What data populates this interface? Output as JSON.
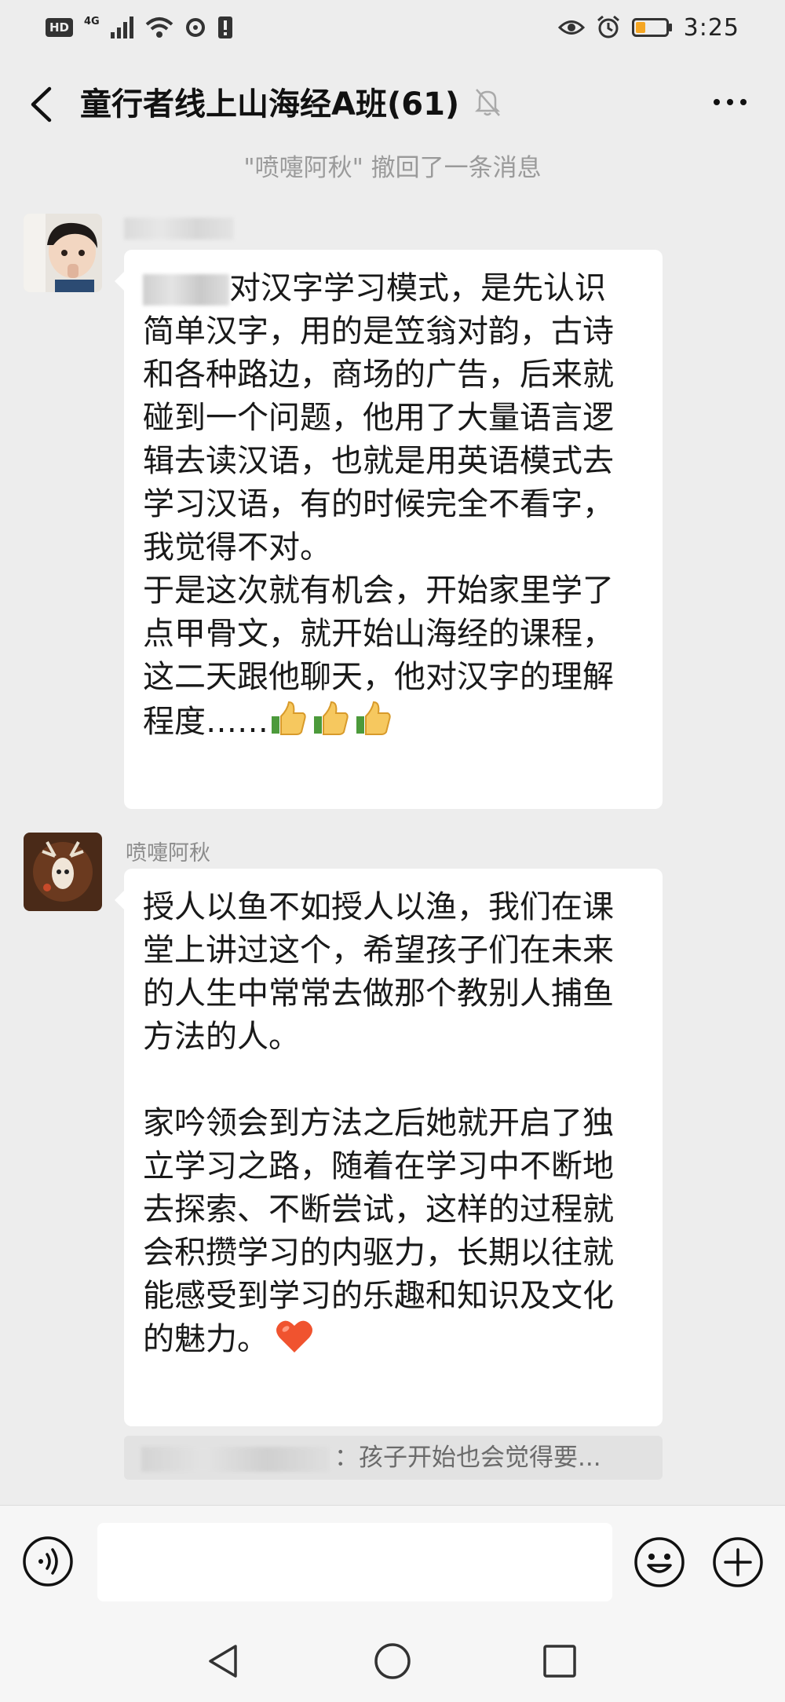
{
  "status_bar": {
    "hd": "HD",
    "network": "4G",
    "time": "3:25",
    "icons": [
      "signal-icon",
      "wifi-icon",
      "sync-icon",
      "notification-icon",
      "eye-icon",
      "alarm-icon",
      "battery-icon"
    ],
    "battery_color": "#f5a623"
  },
  "header": {
    "title": "童行者线上山海经A班(61)",
    "icons": [
      "back-arrow-icon",
      "mute-bell-icon",
      "more-dots-icon"
    ]
  },
  "system_message": "\"喷嚏阿秋\" 撤回了一条消息",
  "messages": [
    {
      "sender": "",
      "text_first_line": "对汉字学习模式，是先认识",
      "text_rest": "简单汉字，用的是笠翁对韵，古诗\n和各种路边，商场的广告，后来就\n碰到一个问题，他用了大量语言逻\n辑去读汉语，也就是用英语模式去\n学习汉语，有的时候完全不看字，\n我觉得不对。\n于是这次就有机会，开始家里学了\n点甲骨文，就开始山海经的课程，\n这二天跟他聊天，他对汉字的理解\n程度……",
      "emoji": "thumbs-up-icon"
    },
    {
      "sender": "喷嚏阿秋",
      "paragraph_1": "授人以鱼不如授人以渔，我们在课\n堂上讲过这个，希望孩子们在未来\n的人生中常常去做那个教别人捕鱼\n方法的人。",
      "paragraph_2": "家吟领会到方法之后她就开启了独\n立学习之路，随着在学习中不断地\n去探索、不断尝试，这样的过程就\n会积攒学习的内驱力，长期以往就\n能感受到学习的乐趣和知识及文化\n的魅力。",
      "emoji": "heart-icon"
    }
  ],
  "quoted_reply": "：孩子开始也会觉得要...",
  "input_bar": {
    "placeholder": "",
    "icons": [
      "voice-icon",
      "emoji-icon",
      "plus-icon"
    ]
  },
  "nav_bar": {
    "icons": [
      "nav-back-icon",
      "nav-home-icon",
      "nav-recent-icon"
    ]
  }
}
